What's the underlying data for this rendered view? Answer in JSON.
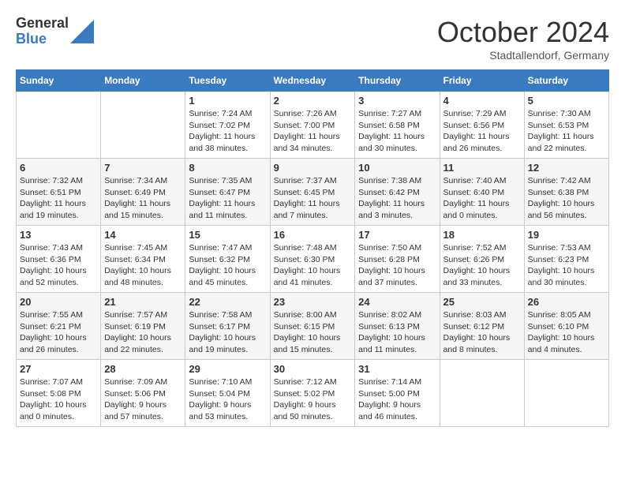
{
  "header": {
    "logo_general": "General",
    "logo_blue": "Blue",
    "month_title": "October 2024",
    "location": "Stadtallendorf, Germany"
  },
  "weekdays": [
    "Sunday",
    "Monday",
    "Tuesday",
    "Wednesday",
    "Thursday",
    "Friday",
    "Saturday"
  ],
  "weeks": [
    [
      {
        "day": "",
        "info": ""
      },
      {
        "day": "",
        "info": ""
      },
      {
        "day": "1",
        "info": "Sunrise: 7:24 AM\nSunset: 7:02 PM\nDaylight: 11 hours and 38 minutes."
      },
      {
        "day": "2",
        "info": "Sunrise: 7:26 AM\nSunset: 7:00 PM\nDaylight: 11 hours and 34 minutes."
      },
      {
        "day": "3",
        "info": "Sunrise: 7:27 AM\nSunset: 6:58 PM\nDaylight: 11 hours and 30 minutes."
      },
      {
        "day": "4",
        "info": "Sunrise: 7:29 AM\nSunset: 6:56 PM\nDaylight: 11 hours and 26 minutes."
      },
      {
        "day": "5",
        "info": "Sunrise: 7:30 AM\nSunset: 6:53 PM\nDaylight: 11 hours and 22 minutes."
      }
    ],
    [
      {
        "day": "6",
        "info": "Sunrise: 7:32 AM\nSunset: 6:51 PM\nDaylight: 11 hours and 19 minutes."
      },
      {
        "day": "7",
        "info": "Sunrise: 7:34 AM\nSunset: 6:49 PM\nDaylight: 11 hours and 15 minutes."
      },
      {
        "day": "8",
        "info": "Sunrise: 7:35 AM\nSunset: 6:47 PM\nDaylight: 11 hours and 11 minutes."
      },
      {
        "day": "9",
        "info": "Sunrise: 7:37 AM\nSunset: 6:45 PM\nDaylight: 11 hours and 7 minutes."
      },
      {
        "day": "10",
        "info": "Sunrise: 7:38 AM\nSunset: 6:42 PM\nDaylight: 11 hours and 3 minutes."
      },
      {
        "day": "11",
        "info": "Sunrise: 7:40 AM\nSunset: 6:40 PM\nDaylight: 11 hours and 0 minutes."
      },
      {
        "day": "12",
        "info": "Sunrise: 7:42 AM\nSunset: 6:38 PM\nDaylight: 10 hours and 56 minutes."
      }
    ],
    [
      {
        "day": "13",
        "info": "Sunrise: 7:43 AM\nSunset: 6:36 PM\nDaylight: 10 hours and 52 minutes."
      },
      {
        "day": "14",
        "info": "Sunrise: 7:45 AM\nSunset: 6:34 PM\nDaylight: 10 hours and 48 minutes."
      },
      {
        "day": "15",
        "info": "Sunrise: 7:47 AM\nSunset: 6:32 PM\nDaylight: 10 hours and 45 minutes."
      },
      {
        "day": "16",
        "info": "Sunrise: 7:48 AM\nSunset: 6:30 PM\nDaylight: 10 hours and 41 minutes."
      },
      {
        "day": "17",
        "info": "Sunrise: 7:50 AM\nSunset: 6:28 PM\nDaylight: 10 hours and 37 minutes."
      },
      {
        "day": "18",
        "info": "Sunrise: 7:52 AM\nSunset: 6:26 PM\nDaylight: 10 hours and 33 minutes."
      },
      {
        "day": "19",
        "info": "Sunrise: 7:53 AM\nSunset: 6:23 PM\nDaylight: 10 hours and 30 minutes."
      }
    ],
    [
      {
        "day": "20",
        "info": "Sunrise: 7:55 AM\nSunset: 6:21 PM\nDaylight: 10 hours and 26 minutes."
      },
      {
        "day": "21",
        "info": "Sunrise: 7:57 AM\nSunset: 6:19 PM\nDaylight: 10 hours and 22 minutes."
      },
      {
        "day": "22",
        "info": "Sunrise: 7:58 AM\nSunset: 6:17 PM\nDaylight: 10 hours and 19 minutes."
      },
      {
        "day": "23",
        "info": "Sunrise: 8:00 AM\nSunset: 6:15 PM\nDaylight: 10 hours and 15 minutes."
      },
      {
        "day": "24",
        "info": "Sunrise: 8:02 AM\nSunset: 6:13 PM\nDaylight: 10 hours and 11 minutes."
      },
      {
        "day": "25",
        "info": "Sunrise: 8:03 AM\nSunset: 6:12 PM\nDaylight: 10 hours and 8 minutes."
      },
      {
        "day": "26",
        "info": "Sunrise: 8:05 AM\nSunset: 6:10 PM\nDaylight: 10 hours and 4 minutes."
      }
    ],
    [
      {
        "day": "27",
        "info": "Sunrise: 7:07 AM\nSunset: 5:08 PM\nDaylight: 10 hours and 0 minutes."
      },
      {
        "day": "28",
        "info": "Sunrise: 7:09 AM\nSunset: 5:06 PM\nDaylight: 9 hours and 57 minutes."
      },
      {
        "day": "29",
        "info": "Sunrise: 7:10 AM\nSunset: 5:04 PM\nDaylight: 9 hours and 53 minutes."
      },
      {
        "day": "30",
        "info": "Sunrise: 7:12 AM\nSunset: 5:02 PM\nDaylight: 9 hours and 50 minutes."
      },
      {
        "day": "31",
        "info": "Sunrise: 7:14 AM\nSunset: 5:00 PM\nDaylight: 9 hours and 46 minutes."
      },
      {
        "day": "",
        "info": ""
      },
      {
        "day": "",
        "info": ""
      }
    ]
  ]
}
